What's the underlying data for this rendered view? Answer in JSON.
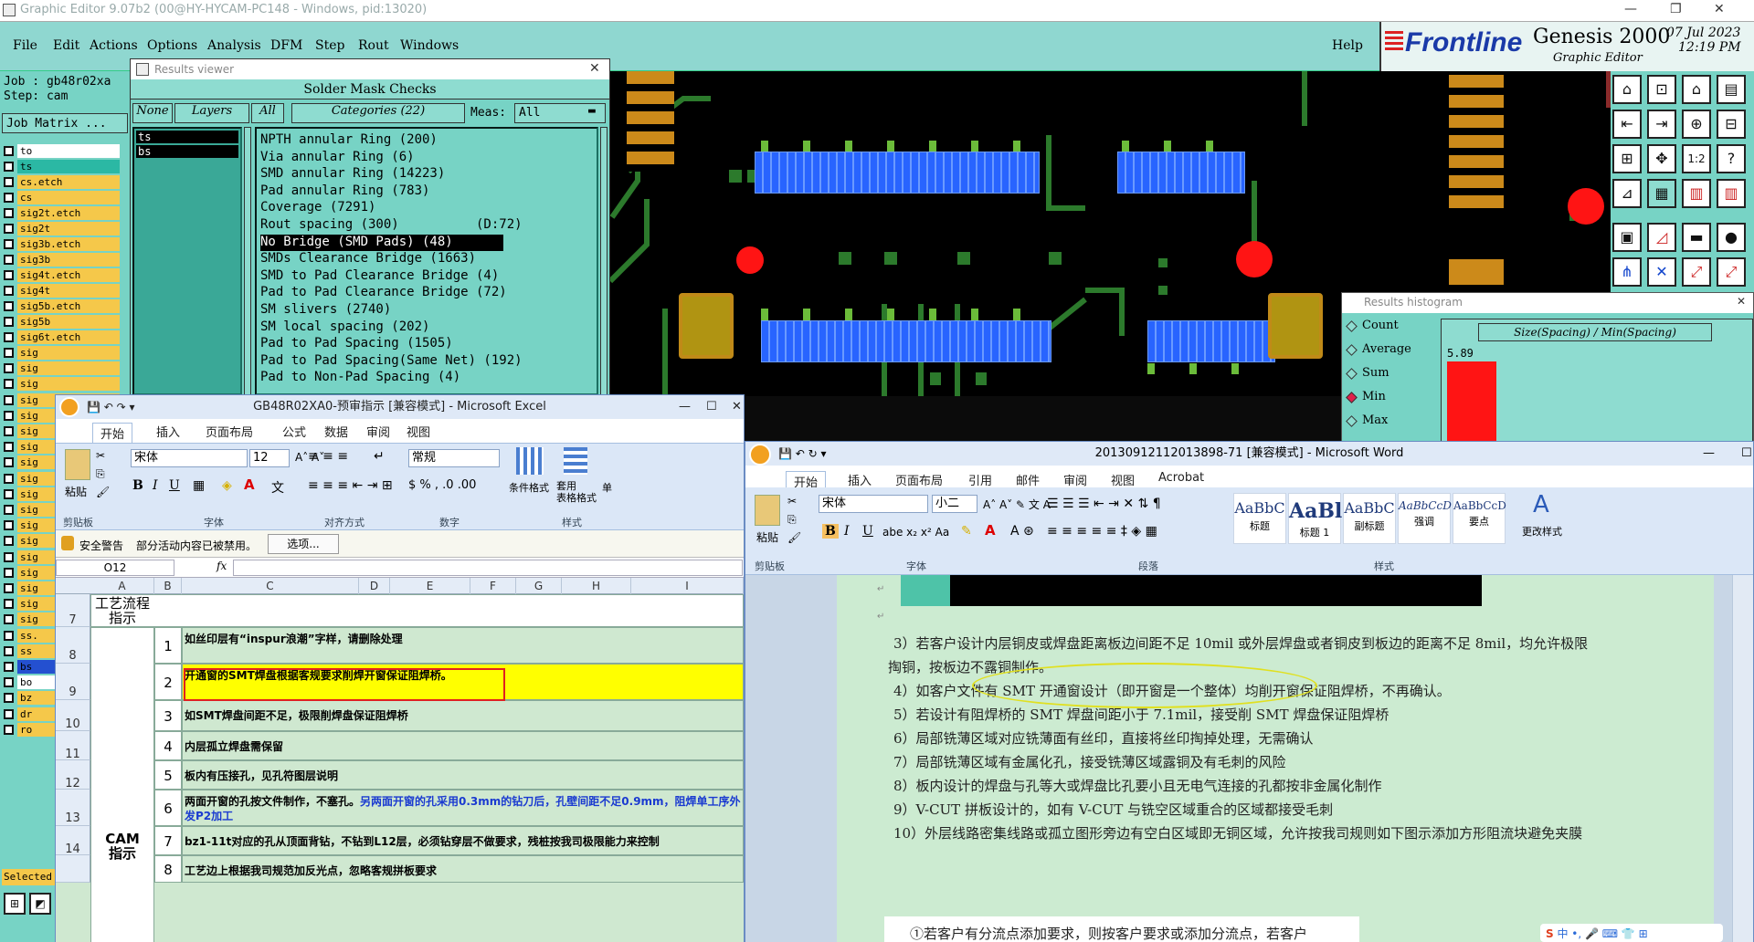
{
  "genesis": {
    "title": "Graphic Editor 9.07b2 (00@HY-HYCAM-PC148 - Windows, pid:13020)",
    "menu": [
      "File",
      "Edit",
      "Actions",
      "Options",
      "Analysis",
      "DFM",
      "Step",
      "Rout",
      "Windows"
    ],
    "help": "Help",
    "brand": "Frontline",
    "product": "Genesis 2000",
    "product_sub": "Graphic Editor",
    "date": "07 Jul 2023",
    "time": "12:19 PM",
    "job_label": "Job : gb48r02xa",
    "step_label": "Step: cam",
    "job_matrix": "Job Matrix ...",
    "layers": [
      {
        "name": "to",
        "color": "#ffffff"
      },
      {
        "name": "ts",
        "color": "#2bb8a4"
      },
      {
        "name": "cs.etch",
        "color": "#f5c84a"
      },
      {
        "name": "cs",
        "color": "#f5c84a"
      },
      {
        "name": "sig2t.etch",
        "color": "#f5c84a"
      },
      {
        "name": "sig2t",
        "color": "#f5c84a"
      },
      {
        "name": "sig3b.etch",
        "color": "#f5c84a"
      },
      {
        "name": "sig3b",
        "color": "#f5c84a"
      },
      {
        "name": "sig4t.etch",
        "color": "#f5c84a"
      },
      {
        "name": "sig4t",
        "color": "#f5c84a"
      },
      {
        "name": "sig5b.etch",
        "color": "#f5c84a"
      },
      {
        "name": "sig5b",
        "color": "#f5c84a"
      },
      {
        "name": "sig6t.etch",
        "color": "#f5c84a"
      }
    ],
    "layers_tail": [
      "sig",
      "sig",
      "sig",
      "sig",
      "sig",
      "sig",
      "sig",
      "sig",
      "sig",
      "sig",
      "sig",
      "sig",
      "sig",
      "sig",
      "sig",
      "sig",
      "sig",
      "sig",
      "ss.",
      "ss",
      "bs",
      "bo",
      "bz",
      "dr",
      "ro"
    ],
    "selected_label": "Selected"
  },
  "results_viewer": {
    "title": "Results viewer",
    "section": "Solder Mask Checks",
    "none_btn": "None",
    "layers_btn": "Layers",
    "all_btn": "All",
    "categories_btn": "Categories (22)",
    "meas_label": "Meas:",
    "meas_value": "All",
    "layers": [
      "ts",
      "bs"
    ],
    "categories": [
      "NPTH annular Ring (200)",
      "Via annular Ring (6)",
      "SMD annular Ring (14223)",
      "Pad annular Ring (783)",
      "Coverage (7291)",
      "Rout spacing (300)          (D:72)",
      "No Bridge (SMD Pads) (48)",
      "SMDs Clearance Bridge (1663)",
      "SMD to Pad Clearance Bridge (4)",
      "Pad to Pad Clearance Bridge (72)",
      "SM slivers (2740)",
      "SM local spacing (202)",
      "Pad to Pad Spacing (1505)",
      "Pad to Pad Spacing(Same Net) (192)",
      "Pad to Non-Pad Spacing (4)"
    ],
    "selected_index": 6
  },
  "histogram": {
    "title": "Results histogram",
    "options": [
      "Count",
      "Average",
      "Sum",
      "Min",
      "Max"
    ],
    "selected": "Min",
    "header": "Size(Spacing) / Min(Spacing)",
    "bar_value": "5.89"
  },
  "excel": {
    "title": "GB48R02XA0-预审指示  [兼容模式] - Microsoft Excel",
    "tabs": [
      "开始",
      "插入",
      "页面布局",
      "公式",
      "数据",
      "审阅",
      "视图"
    ],
    "font": "宋体",
    "font_size": "12",
    "number_format": "常规",
    "groups": [
      "剪贴板",
      "字体",
      "对齐方式",
      "数字",
      "样式"
    ],
    "paste": "粘贴",
    "cond_format": "条件格式",
    "table_format": "套用\n表格格式",
    "cell_style": "单",
    "security_warning": "安全警告",
    "security_msg": "部分活动内容已被禁用。",
    "options_btn": "选项...",
    "name_box": "O12",
    "fx": "fx",
    "columns": [
      "A",
      "B",
      "C",
      "D",
      "E",
      "F",
      "G",
      "H",
      "I"
    ],
    "header_cell": "工艺流程\n指示",
    "section_label": "CAM\n指示",
    "rows": [
      {
        "row": "7",
        "num": "",
        "text": ""
      },
      {
        "row": "8",
        "num": "1",
        "text": "如丝印层有“inspur浪潮”字样，请删除处理"
      },
      {
        "row": "9",
        "num": "2",
        "text": "开通窗的SMT焊盘根据客规要求削焊开窗保证阻焊桥。"
      },
      {
        "row": "10",
        "num": "3",
        "text": "如SMT焊盘间距不足，极限削焊盘保证阻焊桥"
      },
      {
        "row": "11",
        "num": "4",
        "text": "内层孤立焊盘需保留"
      },
      {
        "row": "12",
        "num": "5",
        "text": "板内有压接孔，见孔符图层说明"
      },
      {
        "row": "13",
        "num": "6",
        "text": "两面开窗的孔按文件制作，不塞孔。",
        "text2": "另两面开窗的孔采用0.3mm的钻刀后，孔壁间距不足0.9mm，阻焊单工序外发P2加工"
      },
      {
        "row": "14",
        "num": "7",
        "text": "bz1-11t对应的孔从顶面背钻，不钻到L12层，必须钻穿层不做要求，残桩按我司极限能力来控制"
      },
      {
        "row": "",
        "num": "8",
        "text": "工艺边上根据我司规范加反光点，忽略客规拼板要求"
      }
    ]
  },
  "word": {
    "title": "20130912112013898-71 [兼容模式] - Microsoft Word",
    "tabs": [
      "开始",
      "插入",
      "页面布局",
      "引用",
      "邮件",
      "审阅",
      "视图",
      "Acrobat"
    ],
    "font": "宋体",
    "font_size": "小二",
    "groups": [
      "剪贴板",
      "字体",
      "段落",
      "样式"
    ],
    "paste": "粘贴",
    "styles": [
      {
        "sample": "AaBbC",
        "name": "标题"
      },
      {
        "sample": "AaBl",
        "name": "标题 1"
      },
      {
        "sample": "AaBbC",
        "name": "副标题"
      },
      {
        "sample": "AaBbCcD",
        "name": "强调"
      },
      {
        "sample": "AaBbCcD",
        "name": "要点"
      }
    ],
    "change_styles": "更改样式",
    "lines": [
      "3）若客户设计内层铜皮或焊盘距离板边间距不足 10mil 或外层焊盘或者铜皮到板边的距离不足 8mil，均允许极限",
      "掏铜，按板边不露铜制作。",
      "4）如客户文件有 SMT 开通窗设计（即开窗是一个整体）均削开窗保证阻焊桥，不再确认。",
      "5）若设计有阻焊桥的 SMT 焊盘间距小于 7.1mil，接受削 SMT 焊盘保证阻焊桥",
      "6）局部铣薄区域对应铣薄面有丝印，直接将丝印掏掉处理，无需确认",
      "7）局部铣薄区域有金属化孔，接受铣薄区域露铜及有毛刺的风险",
      "8）板内设计的焊盘与孔等大或焊盘比孔要小且无电气连接的孔都按非金属化制作",
      "9）V-CUT 拼板设计的，如有 V-CUT 与铣空区域重合的区域都接受毛刺",
      "10）外层线路密集线路或孤立图形旁边有空白区域即无铜区域，允许按我司规则如下图示添加方形阻流块避免夹膜"
    ],
    "cut_line": "①若客户有分流点添加要求，则按客户要求或添加分流点，若客户"
  },
  "colors": {
    "genesis_bg": "#77d3c5",
    "highlight": "#ffff00",
    "annot_red": "#e02020"
  }
}
